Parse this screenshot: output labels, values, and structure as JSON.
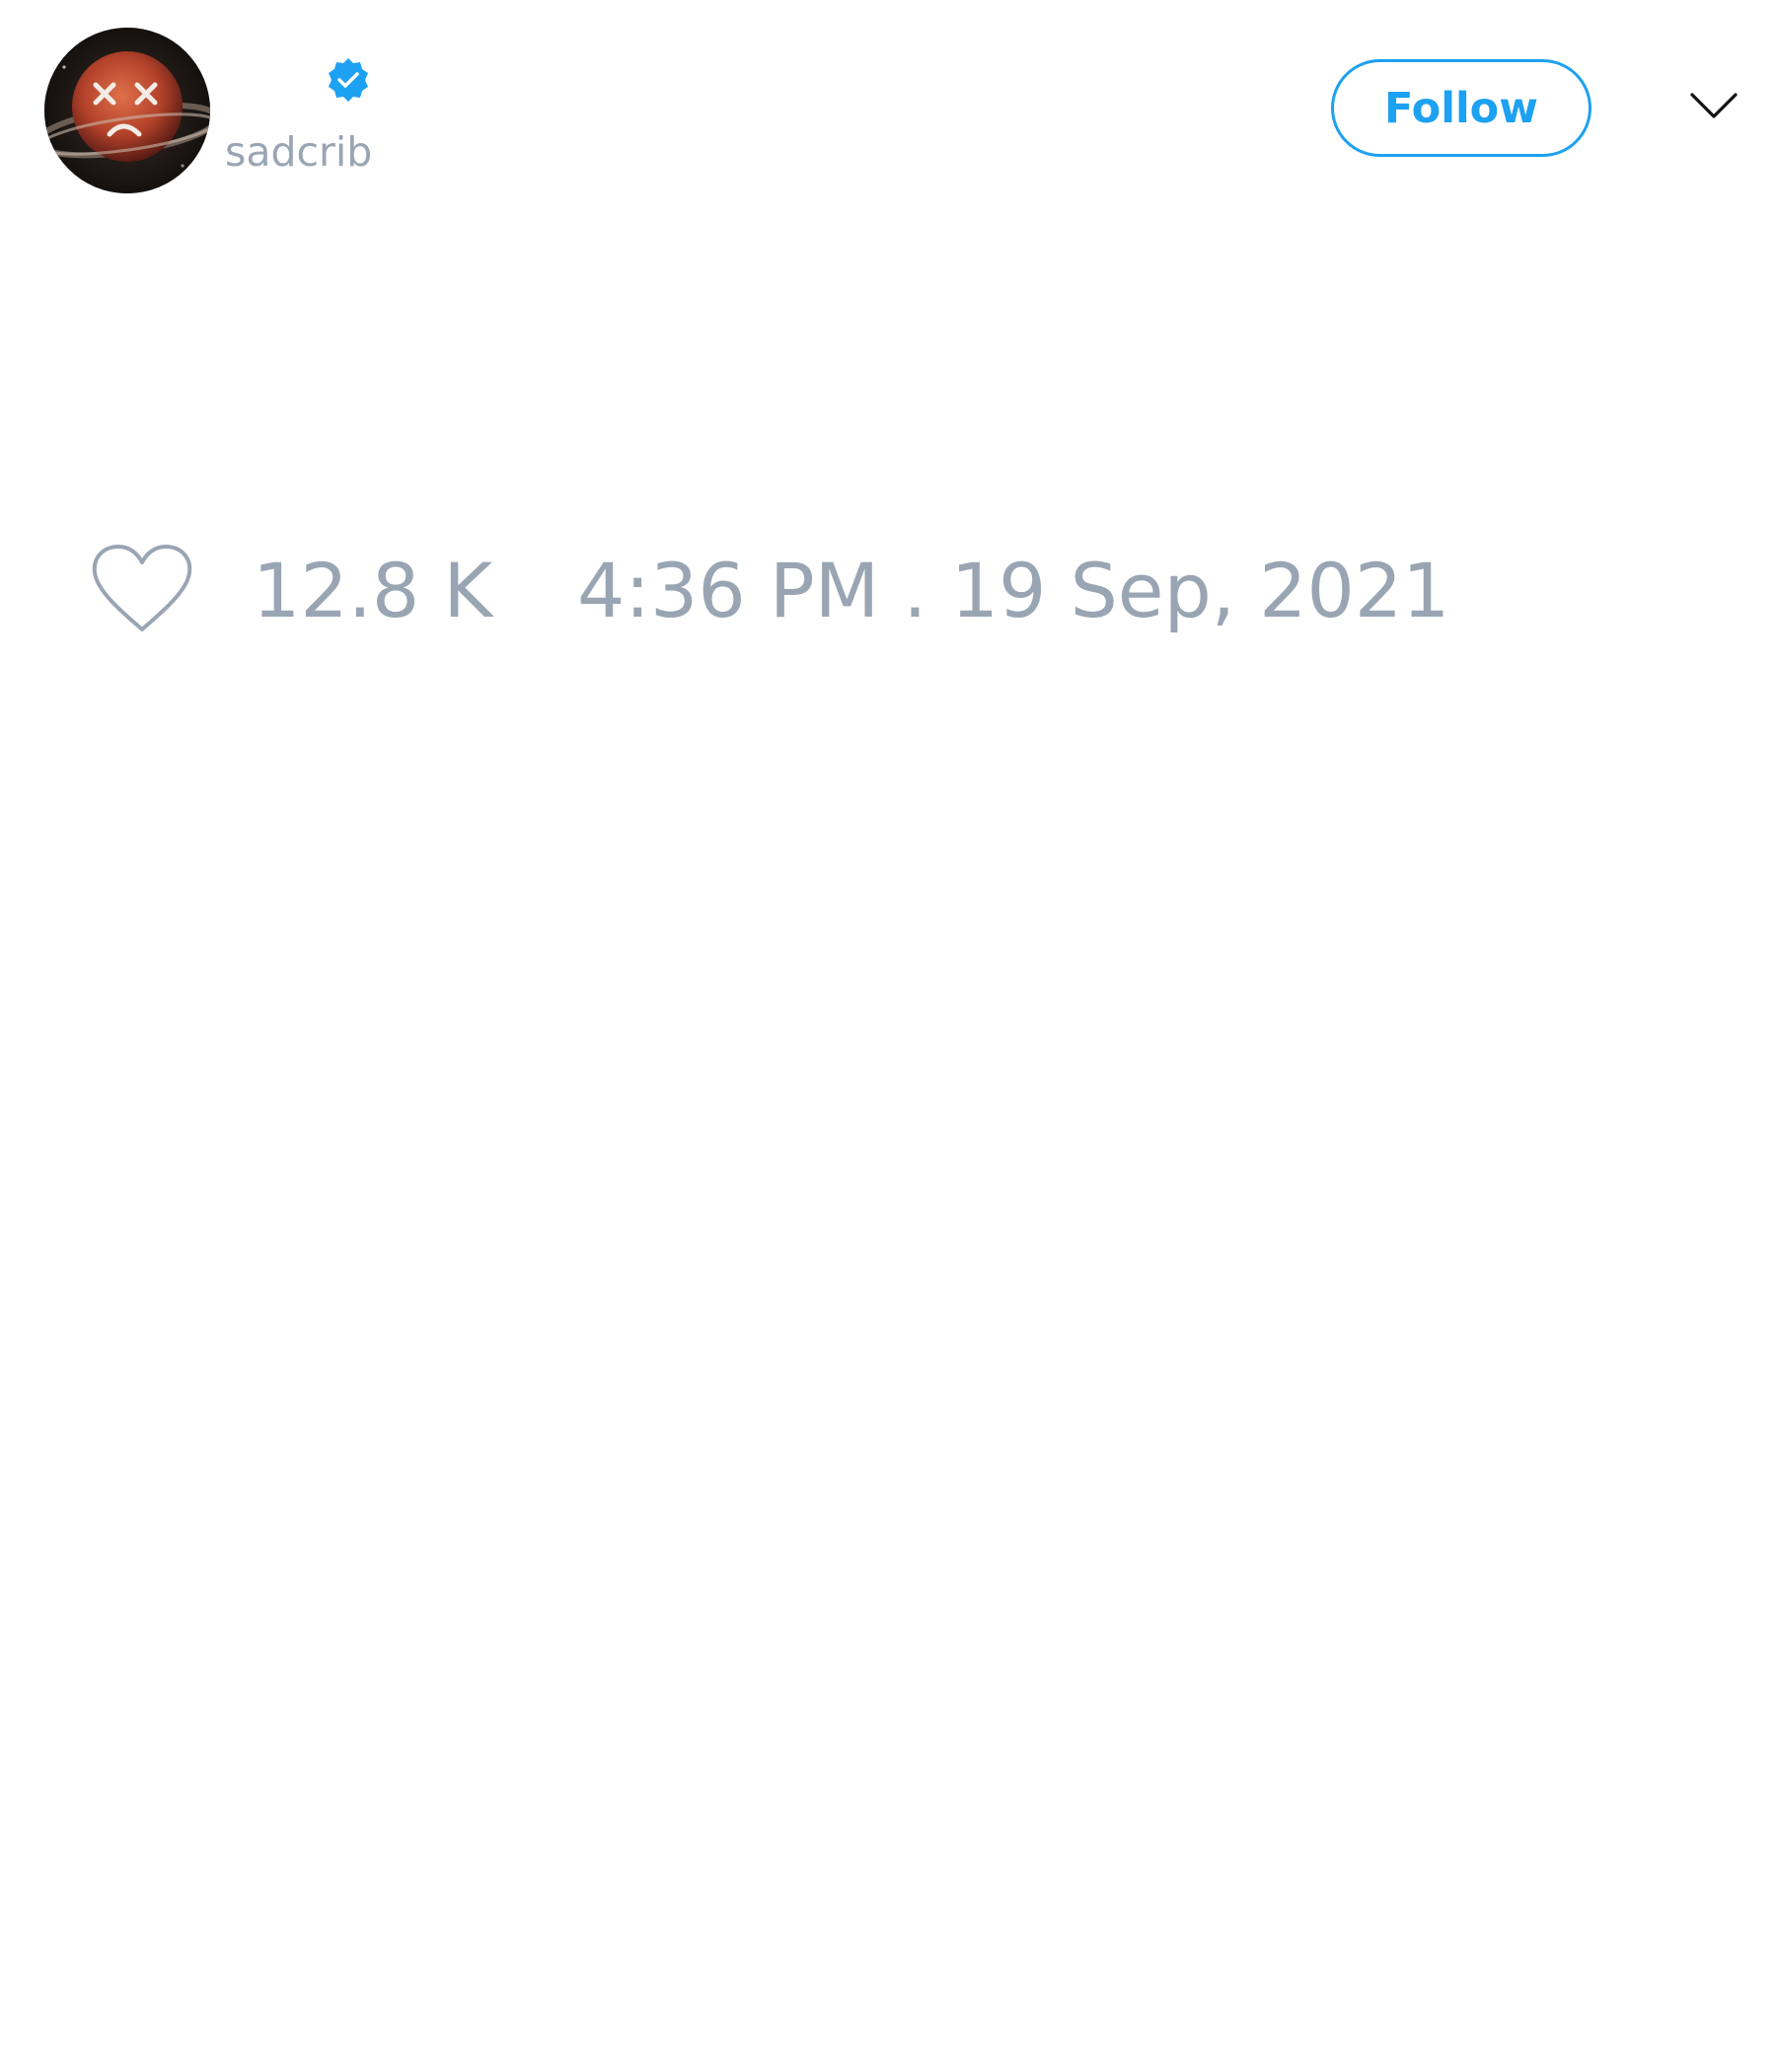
{
  "tweet": {
    "author": {
      "display_name": "",
      "handle": "sadcrib",
      "verified": true
    },
    "follow_label": "Follow",
    "likes": "12.8 K",
    "timestamp": "4:36 PM . 19 Sep, 2021"
  },
  "icons": {
    "avatar": "sad-face-planet-avatar",
    "verified": "verified-badge-icon",
    "menu": "chevron-down-icon",
    "like": "heart-icon"
  },
  "colors": {
    "accent": "#1da1f2",
    "muted_text": "#9aa5b3",
    "background": "#ffffff",
    "icon_stroke": "#9aa5b3",
    "chevron": "#111111"
  }
}
